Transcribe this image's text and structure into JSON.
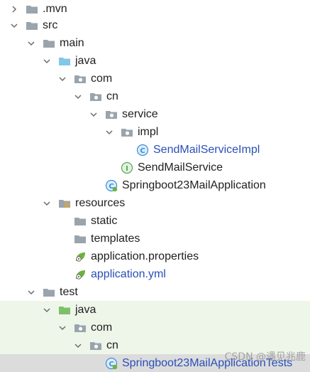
{
  "tree": {
    "mvn": ".mvn",
    "src": "src",
    "main": "main",
    "java_main": "java",
    "com_main": "com",
    "cn_main": "cn",
    "service": "service",
    "impl": "impl",
    "send_mail_service_impl": "SendMailServiceImpl",
    "send_mail_service": "SendMailService",
    "application_class": "Springboot23MailApplication",
    "resources": "resources",
    "static": "static",
    "templates": "templates",
    "application_properties": "application.properties",
    "application_yml": "application.yml",
    "test": "test",
    "java_test": "java",
    "com_test": "com",
    "cn_test": "cn",
    "application_tests": "Springboot23MailApplicationTests"
  },
  "watermark": "CSDN @遇见兆鹿",
  "colors": {
    "folder": "#9aa4ad",
    "source_folder": "#82c7e8",
    "test_folder": "#7fbf6a",
    "class_icon": "#3b8fd9",
    "interface_icon": "#58a55c",
    "modified_text": "#2a4fb7",
    "test_row_bg": "#eef6ea",
    "selected_row_bg": "#dcdcdc"
  }
}
